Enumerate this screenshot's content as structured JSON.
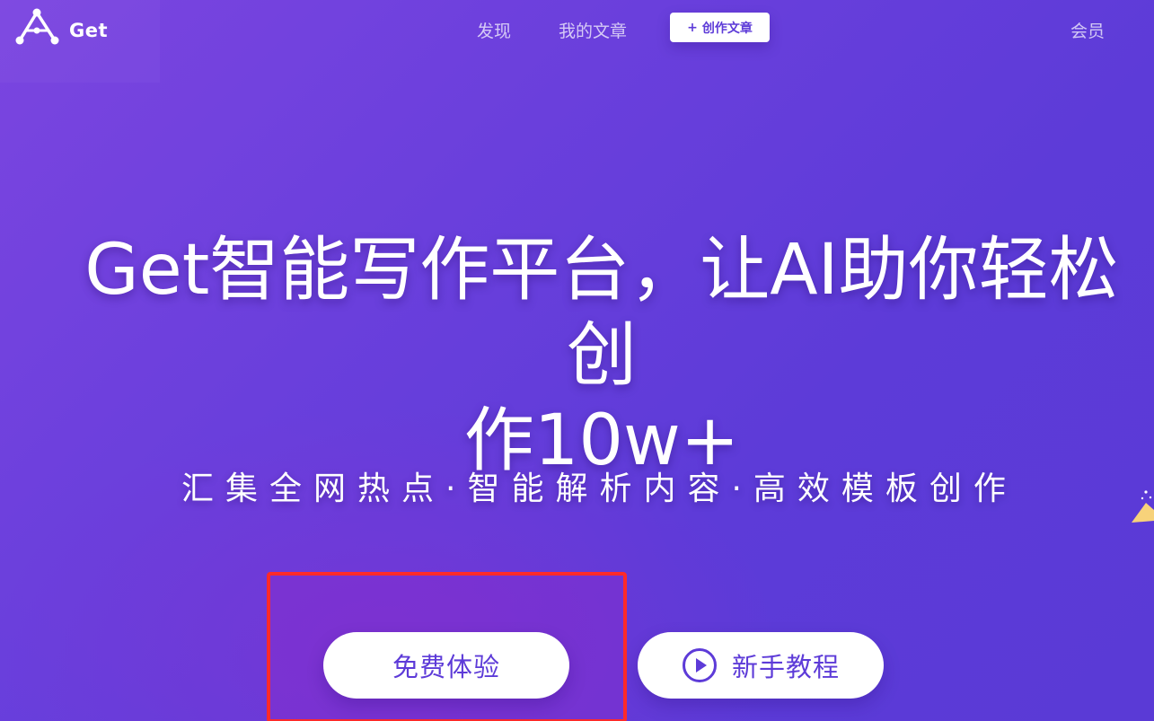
{
  "header": {
    "logo_text": "Get",
    "nav": {
      "discover": "发现",
      "my_articles": "我的文章",
      "create_article": "创作文章",
      "create_plus": "+",
      "member": "会员"
    }
  },
  "hero": {
    "title_line1": "Get智能写作平台，让AI助你轻松创",
    "title_line2": "作10w+",
    "subtitle": "汇集全网热点·智能解析内容·高效模板创作"
  },
  "actions": {
    "free_trial": "免费体验",
    "tutorial": "新手教程"
  },
  "colors": {
    "background": "#6a3fdc",
    "accent": "#5d3bd8",
    "highlight_border": "#ff2a2a",
    "button_bg": "#ffffff"
  },
  "icons": {
    "logo": "logo-triangle-nodes-icon",
    "play": "play-circle-icon",
    "decoration": "star-decoration-icon"
  }
}
